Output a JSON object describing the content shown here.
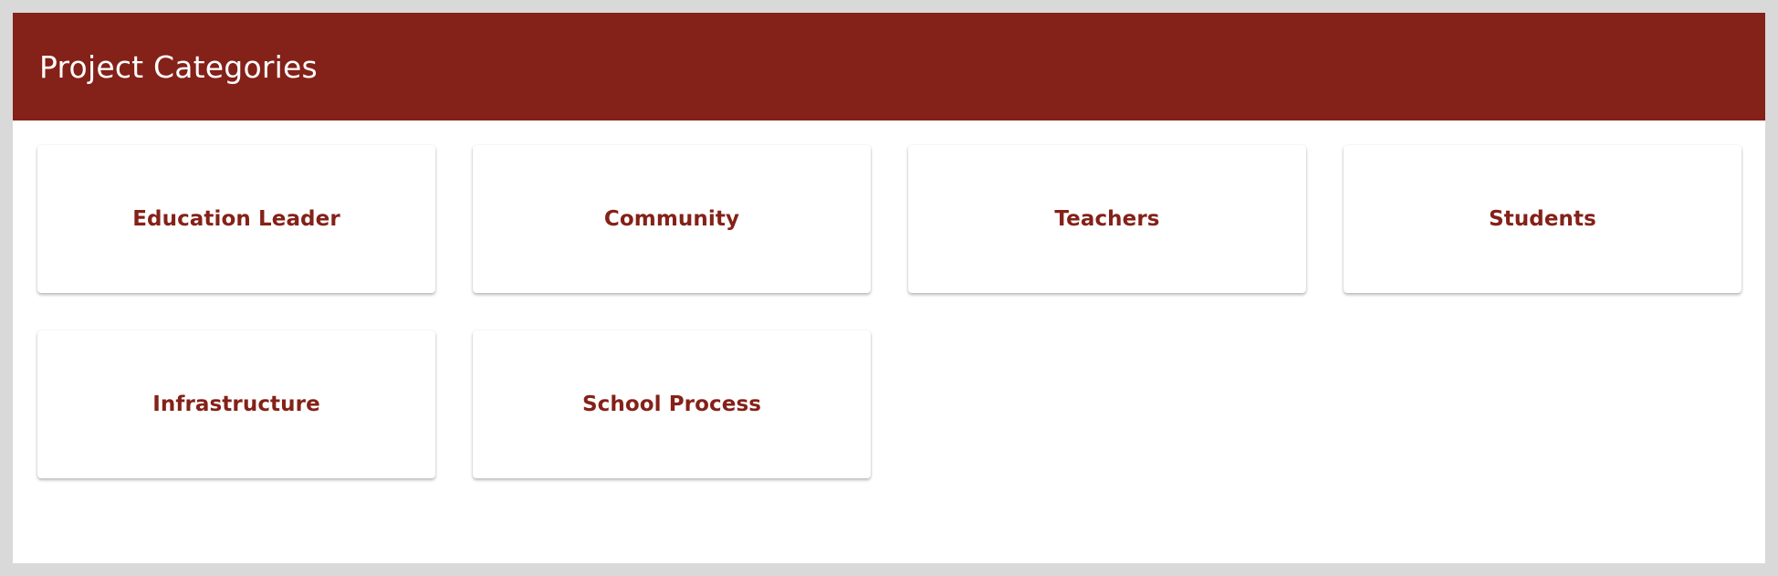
{
  "header": {
    "title": "Project Categories",
    "background_color": "#842118"
  },
  "categories": [
    {
      "label": "Education Leader"
    },
    {
      "label": "Community"
    },
    {
      "label": "Teachers"
    },
    {
      "label": "Students"
    },
    {
      "label": "Infrastructure"
    },
    {
      "label": "School Process"
    }
  ],
  "colors": {
    "accent": "#842118",
    "card_background": "#ffffff",
    "page_background": "#d9d9d9"
  }
}
